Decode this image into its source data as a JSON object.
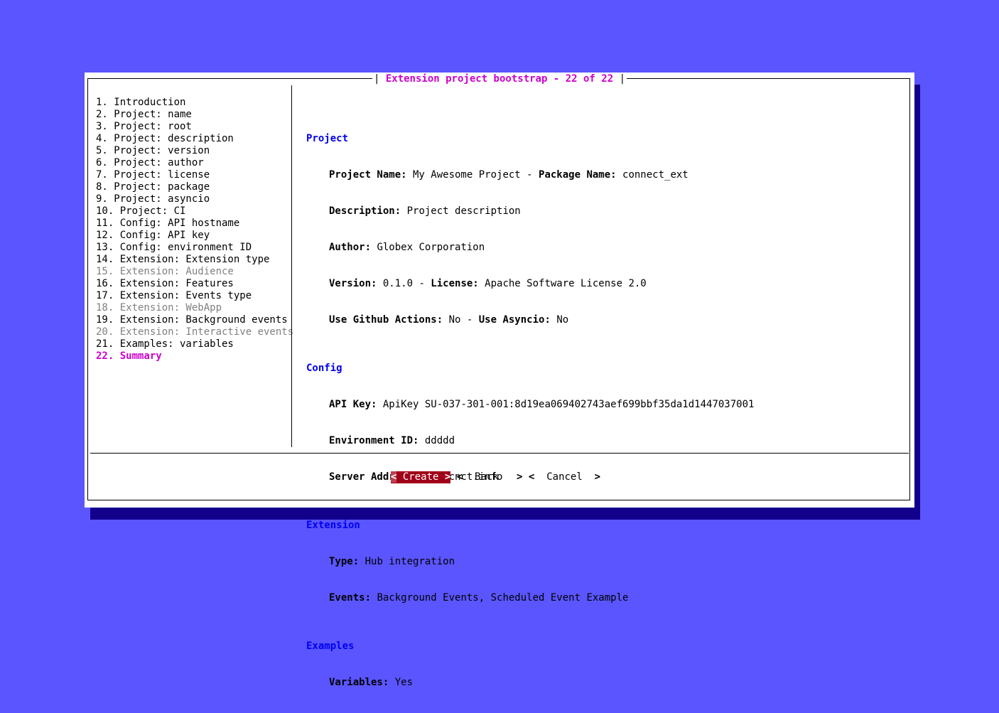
{
  "colors": {
    "background": "#5a55ff",
    "shadow": "#12008a",
    "accent": "#cc00cc",
    "section": "#0000ee",
    "disabled": "#808080",
    "focused_button": "#a00018"
  },
  "dialog": {
    "title_left": "| ",
    "title": "Extension project bootstrap - 22 of 22",
    "title_right": " |"
  },
  "nav": [
    {
      "label": "1. Introduction",
      "state": "normal"
    },
    {
      "label": "2. Project: name",
      "state": "normal"
    },
    {
      "label": "3. Project: root",
      "state": "normal"
    },
    {
      "label": "4. Project: description",
      "state": "normal"
    },
    {
      "label": "5. Project: version",
      "state": "normal"
    },
    {
      "label": "6. Project: author",
      "state": "normal"
    },
    {
      "label": "7. Project: license",
      "state": "normal"
    },
    {
      "label": "8. Project: package",
      "state": "normal"
    },
    {
      "label": "9. Project: asyncio",
      "state": "normal"
    },
    {
      "label": "10. Project: CI",
      "state": "normal"
    },
    {
      "label": "11. Config: API hostname",
      "state": "normal"
    },
    {
      "label": "12. Config: API key",
      "state": "normal"
    },
    {
      "label": "13. Config: environment ID",
      "state": "normal"
    },
    {
      "label": "14. Extension: Extension type",
      "state": "normal"
    },
    {
      "label": "15. Extension: Audience",
      "state": "disabled"
    },
    {
      "label": "16. Extension: Features",
      "state": "normal"
    },
    {
      "label": "17. Extension: Events type",
      "state": "normal"
    },
    {
      "label": "18. Extension: WebApp",
      "state": "disabled"
    },
    {
      "label": "19. Extension: Background events",
      "state": "normal"
    },
    {
      "label": "20. Extension: Interactive events",
      "state": "disabled"
    },
    {
      "label": "21. Examples: variables",
      "state": "normal"
    },
    {
      "label": "22. Summary",
      "state": "active"
    }
  ],
  "summary": {
    "project": {
      "heading": "Project",
      "name_label": "Project Name:",
      "name_value": " My Awesome Project - ",
      "package_label": "Package Name:",
      "package_value": " connect_ext",
      "description_label": "Description:",
      "description_value": " Project description",
      "author_label": "Author:",
      "author_value": " Globex Corporation",
      "version_label": "Version:",
      "version_value": " 0.1.0 - ",
      "license_label": "License:",
      "license_value": " Apache Software License 2.0",
      "github_label": "Use Github Actions:",
      "github_value": " No - ",
      "asyncio_label": "Use Asyncio:",
      "asyncio_value": " No"
    },
    "config": {
      "heading": "Config",
      "apikey_label": "API Key:",
      "apikey_value": " ApiKey SU-037-301-001:8d19ea069402743aef699bbf35da1d1447037001",
      "env_label": "Environment ID:",
      "env_value": " ddddd",
      "server_label": "Server Address:",
      "server_value": " api.cnct.info"
    },
    "extension": {
      "heading": "Extension",
      "type_label": "Type:",
      "type_value": " Hub integration",
      "events_label": "Events:",
      "events_value": " Background Events, Scheduled Event Example"
    },
    "examples": {
      "heading": "Examples",
      "variables_label": "Variables:",
      "variables_value": " Yes"
    }
  },
  "buttons": {
    "create": {
      "lt": "<",
      "label": " Create ",
      "gt": ">"
    },
    "back": {
      "lt": "<",
      "label": "  Back   ",
      "gt": ">"
    },
    "cancel": {
      "lt": "<",
      "label": "  Cancel  ",
      "gt": ">"
    }
  }
}
